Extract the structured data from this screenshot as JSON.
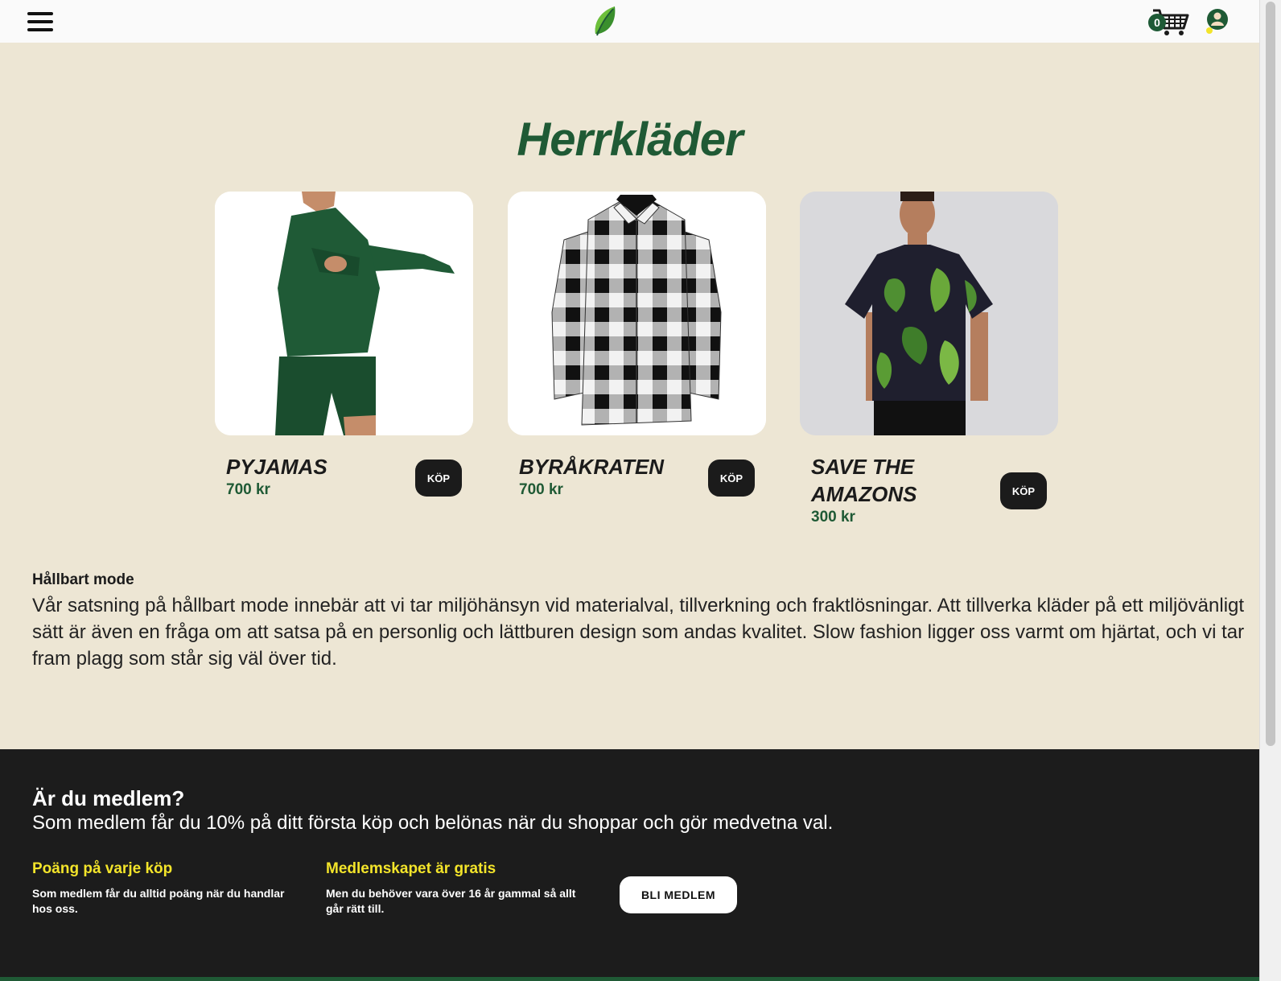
{
  "header": {
    "cart_count": "0"
  },
  "page": {
    "title": "Herrkläder"
  },
  "products": [
    {
      "name": "PYJAMAS",
      "price": "700 kr",
      "buy_label": "KÖP"
    },
    {
      "name": "BYRÅKRATEN",
      "price": "700 kr",
      "buy_label": "KÖP"
    },
    {
      "name": "SAVE THE AMAZONS",
      "price": "300 kr",
      "buy_label": "KÖP"
    }
  ],
  "sustainability": {
    "heading": "Hållbart mode",
    "body": "Vår satsning på hållbart mode innebär att vi tar miljöhänsyn vid materialval, tillverkning och fraktlösningar. Att tillverka kläder på ett miljövänligt sätt är även en fråga om att satsa på en personlig och lättburen design som andas kvalitet. Slow fashion ligger oss varmt om hjärtat, och vi tar fram plagg som står sig väl över tid."
  },
  "membership": {
    "heading": "Är du medlem?",
    "lead": "Som medlem får du 10% på ditt första köp och belönas när du shoppar och gör medvetna val.",
    "perks": [
      {
        "title": "Poäng på varje köp",
        "text": "Som medlem får du alltid poäng när du handlar hos oss."
      },
      {
        "title": "Medlemskapet är gratis",
        "text": "Men du behöver vara över 16 år gammal så allt går rätt till."
      }
    ],
    "join_label": "BLI MEDLEM"
  },
  "colors": {
    "brand_green": "#1f5a35",
    "background": "#ede6d4",
    "footer_dark": "#1c1c1c",
    "accent_yellow": "#f3e42a"
  },
  "icons": [
    "menu-icon",
    "leaf-logo-icon",
    "cart-icon",
    "user-icon"
  ]
}
